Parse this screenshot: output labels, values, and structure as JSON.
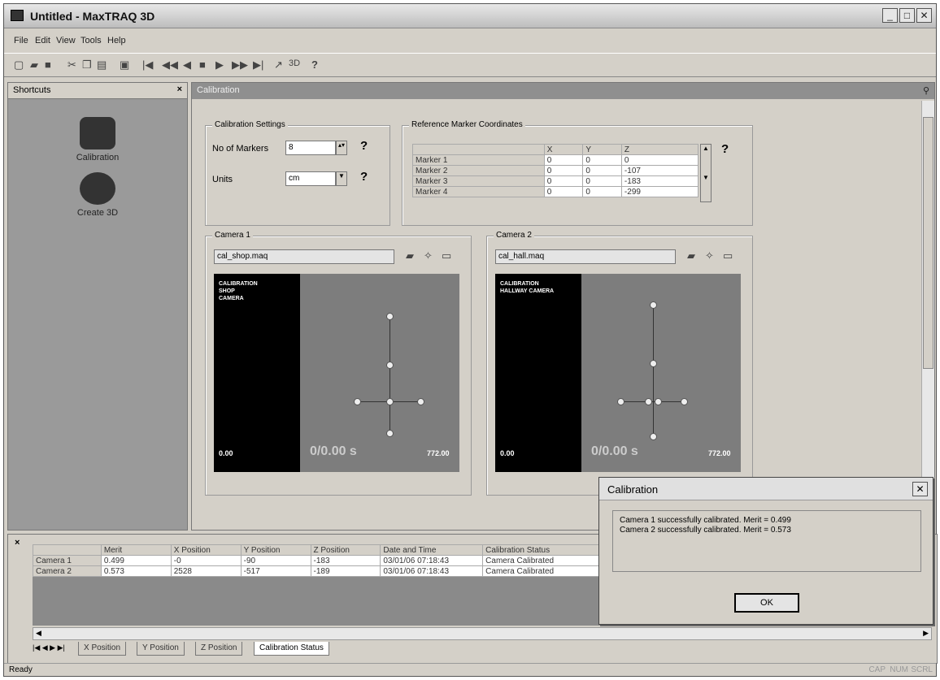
{
  "window": {
    "title": "Untitled - MaxTRAQ 3D",
    "minimize": "_",
    "maximize": "□",
    "close": "✕"
  },
  "menu": [
    "File",
    "Edit",
    "View",
    "Tools",
    "Help"
  ],
  "toolbar": {
    "view_3d": "3D",
    "help_icon": "?"
  },
  "shortcuts": {
    "header": "Shortcuts",
    "close": "×",
    "items": [
      "Calibration",
      "Create 3D"
    ]
  },
  "calibration": {
    "header": "Calibration",
    "settings": {
      "group_label": "Calibration Settings",
      "markers_label": "No of Markers",
      "markers_value": "8",
      "units_label": "Units",
      "units_value": "cm"
    },
    "reference": {
      "group_label": "Reference Marker Coordinates",
      "columns": [
        "",
        "X",
        "Y",
        "Z"
      ],
      "rows": [
        [
          "Marker 1",
          "0",
          "0",
          "0"
        ],
        [
          "Marker 2",
          "0",
          "0",
          "-107"
        ],
        [
          "Marker 3",
          "0",
          "0",
          "-183"
        ],
        [
          "Marker 4",
          "0",
          "0",
          "-299"
        ]
      ]
    },
    "camera1": {
      "label": "Camera 1",
      "file": "cal_shop.maq",
      "overlay_lines": [
        "CALIBRATION",
        "SHOP",
        "CAMERA"
      ],
      "left_num": "0.00",
      "time": "0/0.00 s",
      "right_num": "772.00"
    },
    "camera2": {
      "label": "Camera 2",
      "file": "cal_hall.maq",
      "overlay_lines": [
        "CALIBRATION",
        "HALLWAY CAMERA"
      ],
      "left_num": "0.00",
      "time": "0/0.00 s",
      "right_num": "772.00"
    }
  },
  "results": {
    "columns": [
      "",
      "Merit",
      "X Position",
      "Y Position",
      "Z Position",
      "Date and Time",
      "Calibration Status"
    ],
    "rows": [
      [
        "Camera 1",
        "0.499",
        "-0",
        "-90",
        "-183",
        "03/01/06 07:18:43",
        "Camera Calibrated"
      ],
      [
        "Camera 2",
        "0.573",
        "2528",
        "-517",
        "-189",
        "03/01/06 07:18:43",
        "Camera Calibrated"
      ]
    ],
    "tabs": [
      "X Position",
      "Y Position",
      "Z Position",
      "Calibration Status"
    ]
  },
  "dialog": {
    "title": "Calibration",
    "line1": "Camera 1 successfully calibrated.  Merit = 0.499",
    "line2": "Camera 2 successfully calibrated.  Merit = 0.573",
    "ok": "OK"
  },
  "status": {
    "text": "Ready",
    "indicators": [
      "CAP",
      "NUM",
      "SCRL"
    ]
  }
}
